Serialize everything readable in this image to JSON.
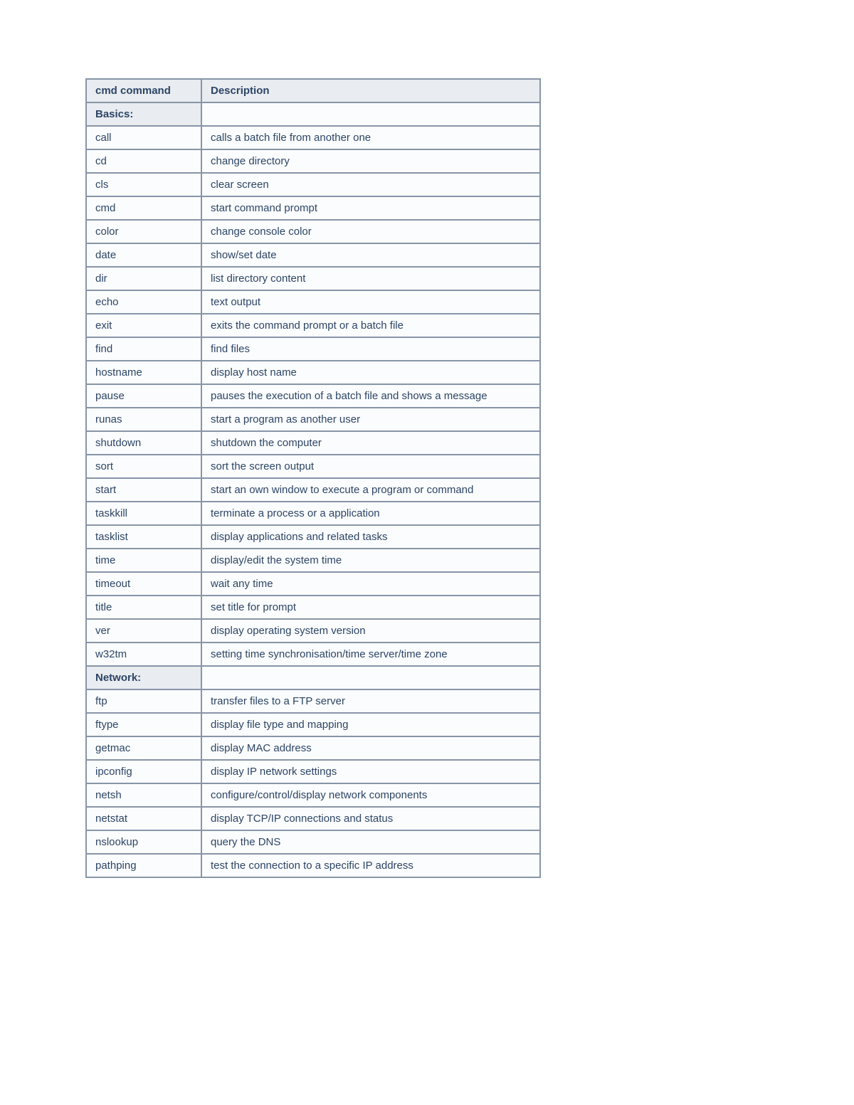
{
  "table": {
    "headers": {
      "cmd": "cmd command",
      "desc": "Description"
    },
    "rows": [
      {
        "type": "section",
        "label": "Basics:"
      },
      {
        "type": "cmd",
        "cmd": "call",
        "desc": "calls a batch file from another one"
      },
      {
        "type": "cmd",
        "cmd": "cd",
        "desc": "change directory"
      },
      {
        "type": "cmd",
        "cmd": "cls",
        "desc": "clear screen"
      },
      {
        "type": "cmd",
        "cmd": "cmd",
        "desc": "start command prompt"
      },
      {
        "type": "cmd",
        "cmd": "color",
        "desc": "change console color"
      },
      {
        "type": "cmd",
        "cmd": "date",
        "desc": "show/set date"
      },
      {
        "type": "cmd",
        "cmd": "dir",
        "desc": "list directory content"
      },
      {
        "type": "cmd",
        "cmd": "echo",
        "desc": "text output"
      },
      {
        "type": "cmd",
        "cmd": "exit",
        "desc": "exits the command prompt or a batch file"
      },
      {
        "type": "cmd",
        "cmd": "find",
        "desc": "find files"
      },
      {
        "type": "cmd",
        "cmd": "hostname",
        "desc": "display host name"
      },
      {
        "type": "cmd",
        "cmd": "pause",
        "desc": "pauses the execution of a batch file and shows a message"
      },
      {
        "type": "cmd",
        "cmd": "runas",
        "desc": "start a program as another user"
      },
      {
        "type": "cmd",
        "cmd": "shutdown",
        "desc": "shutdown the computer"
      },
      {
        "type": "cmd",
        "cmd": "sort",
        "desc": "sort the screen output"
      },
      {
        "type": "cmd",
        "cmd": "start",
        "desc": "start an own window to execute a program or command"
      },
      {
        "type": "cmd",
        "cmd": "taskkill",
        "desc": "terminate a process or a application"
      },
      {
        "type": "cmd",
        "cmd": "tasklist",
        "desc": "display applications and related tasks"
      },
      {
        "type": "cmd",
        "cmd": "time",
        "desc": "display/edit the system time"
      },
      {
        "type": "cmd",
        "cmd": "timeout",
        "desc": "wait any time"
      },
      {
        "type": "cmd",
        "cmd": "title",
        "desc": "set title for prompt"
      },
      {
        "type": "cmd",
        "cmd": "ver",
        "desc": "display operating system version"
      },
      {
        "type": "cmd",
        "cmd": "w32tm",
        "desc": "setting time synchronisation/time server/time zone"
      },
      {
        "type": "section",
        "label": "Network:"
      },
      {
        "type": "cmd",
        "cmd": "ftp",
        "desc": "transfer files to a FTP server"
      },
      {
        "type": "cmd",
        "cmd": "ftype",
        "desc": "display file type and mapping"
      },
      {
        "type": "cmd",
        "cmd": "getmac",
        "desc": "display MAC address"
      },
      {
        "type": "cmd",
        "cmd": "ipconfig",
        "desc": "display IP network settings"
      },
      {
        "type": "cmd",
        "cmd": "netsh",
        "desc": "configure/control/display network components"
      },
      {
        "type": "cmd",
        "cmd": "netstat",
        "desc": "display TCP/IP connections and status"
      },
      {
        "type": "cmd",
        "cmd": "nslookup",
        "desc": "query the DNS"
      },
      {
        "type": "cmd",
        "cmd": "pathping",
        "desc": "test the connection to a specific IP address"
      }
    ]
  }
}
